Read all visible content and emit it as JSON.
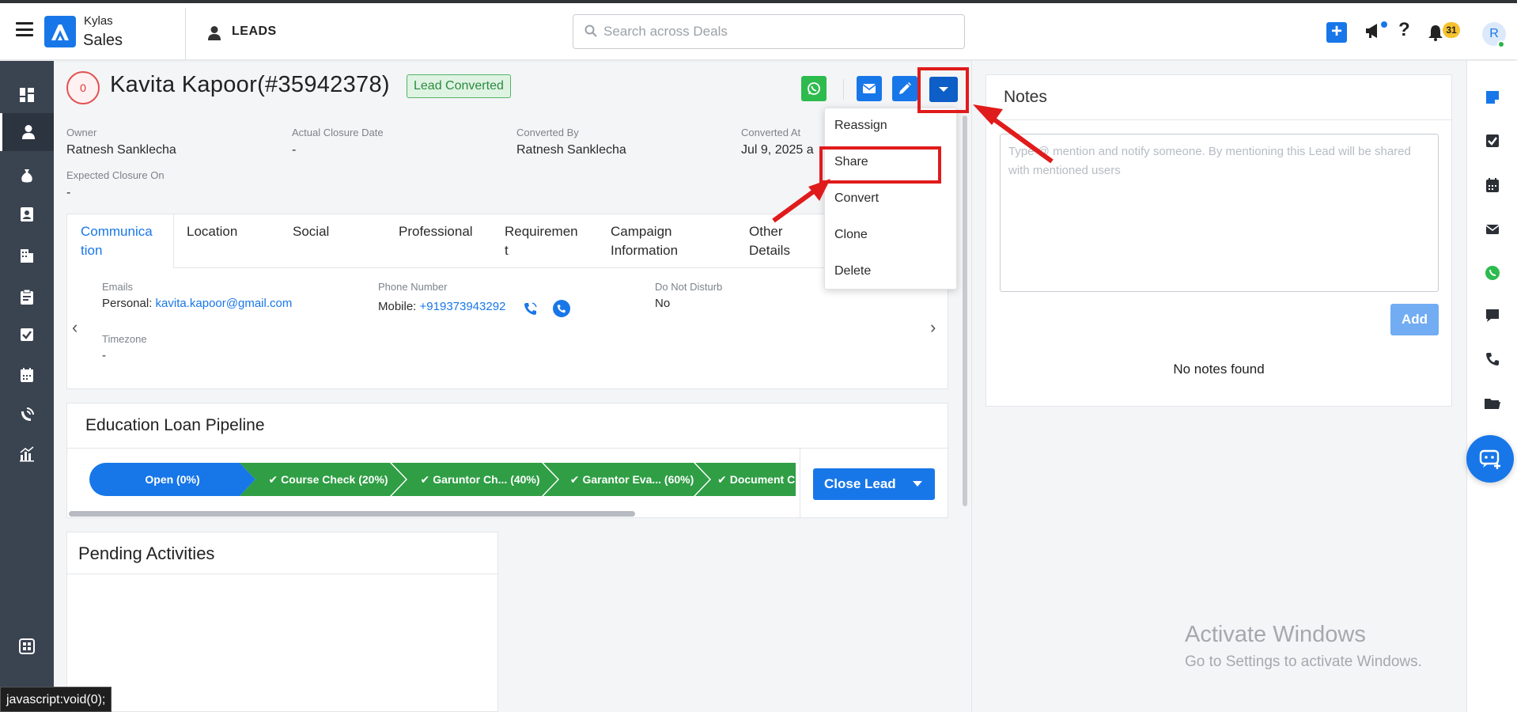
{
  "app": {
    "brand_top": "Kylas",
    "brand_bottom": "Sales",
    "module": "LEADS"
  },
  "search": {
    "placeholder": "Search across Deals"
  },
  "header": {
    "notification_count": "31",
    "avatar_initial": "R"
  },
  "lead": {
    "score": "0",
    "title": "Kavita Kapoor(#35942378)",
    "status_badge": "Lead Converted",
    "fields": {
      "owner_label": "Owner",
      "owner_value": "Ratnesh Sanklecha",
      "actual_closure_label": "Actual Closure Date",
      "actual_closure_value": "-",
      "converted_by_label": "Converted By",
      "converted_by_value": "Ratnesh Sanklecha",
      "converted_at_label": "Converted At",
      "converted_at_value": "Jul 9, 2025 a",
      "expected_closure_label": "Expected Closure On",
      "expected_closure_value": "-"
    }
  },
  "tabs": [
    {
      "line1": "Communica",
      "line2": "tion"
    },
    {
      "line1": "Location",
      "line2": ""
    },
    {
      "line1": "Social",
      "line2": ""
    },
    {
      "line1": "Professional",
      "line2": ""
    },
    {
      "line1": "Requiremen",
      "line2": "t"
    },
    {
      "line1": "Campaign",
      "line2": "Information"
    },
    {
      "line1": "Other",
      "line2": "Details"
    }
  ],
  "communication": {
    "emails_label": "Emails",
    "email_prefix": "Personal:",
    "email_value": "kavita.kapoor@gmail.com",
    "phone_label": "Phone Number",
    "phone_prefix": "Mobile:",
    "phone_value": "+919373943292",
    "dnd_label": "Do Not Disturb",
    "dnd_value": "No",
    "timezone_label": "Timezone",
    "timezone_value": "-"
  },
  "pipeline": {
    "title": "Education Loan Pipeline",
    "stages": [
      {
        "label": "Open (0%)"
      },
      {
        "label": "Course Check (20%)"
      },
      {
        "label": "Garuntor Ch...  (40%)"
      },
      {
        "label": "Garantor Eva... (60%)"
      },
      {
        "label": "Document C..."
      }
    ],
    "close_button": "Close Lead"
  },
  "pending": {
    "title": "Pending Activities"
  },
  "notes": {
    "title": "Notes",
    "placeholder": "Type @ mention and notify someone. By mentioning this Lead will be shared with mentioned users",
    "add_button": "Add",
    "empty_text": "No notes found"
  },
  "more_menu": {
    "items": [
      {
        "label": "Reassign"
      },
      {
        "label": "Share"
      },
      {
        "label": "Convert"
      },
      {
        "label": "Clone"
      },
      {
        "label": "Delete"
      }
    ]
  },
  "watermark": {
    "line1": "Activate Windows",
    "line2": "Go to Settings to activate Windows."
  },
  "status_bar": {
    "url": "javascript:void(0);"
  },
  "colors": {
    "primary": "#1877e8",
    "success": "#2f9e44",
    "annotation": "#e01b1b",
    "sidebar": "#3a4350"
  }
}
